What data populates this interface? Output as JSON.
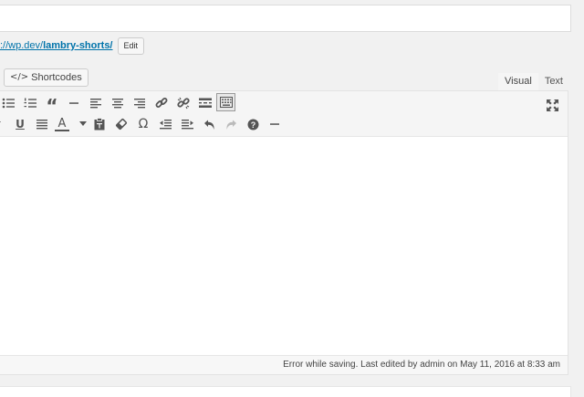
{
  "permalink": {
    "prefix": "://wp.dev/",
    "slug": "lambry-shorts/",
    "edit_label": "Edit"
  },
  "media_buttons": {
    "shortcodes_icon": "</>",
    "shortcodes_label": "Shortcodes"
  },
  "editor_tabs": {
    "visual": "Visual",
    "text": "Text",
    "active": "visual"
  },
  "toolbar": {
    "row1": [
      "bulleted-list-icon",
      "numbered-list-icon",
      "blockquote-icon",
      "horizontal-line-icon",
      "align-left-icon",
      "align-center-icon",
      "align-right-icon",
      "insert-link-icon",
      "remove-link-icon",
      "read-more-icon",
      "toolbar-toggle-icon"
    ],
    "row2": [
      "underline-icon",
      "justify-icon",
      "text-color-icon",
      "paste-as-text-icon",
      "clear-formatting-icon",
      "special-character-icon",
      "outdent-icon",
      "indent-icon",
      "undo-icon",
      "redo-icon",
      "help-icon",
      "horizontal-rule-icon"
    ],
    "glyphs": {
      "blockquote": "“",
      "underline": "U",
      "text_color": "A",
      "special_char": "Ω",
      "help": "?",
      "hr": "—"
    },
    "fullscreen_icon": "distraction-free-icon"
  },
  "status": {
    "text": "Error while saving. Last edited by admin on May 11, 2016 at 8:33 am"
  }
}
